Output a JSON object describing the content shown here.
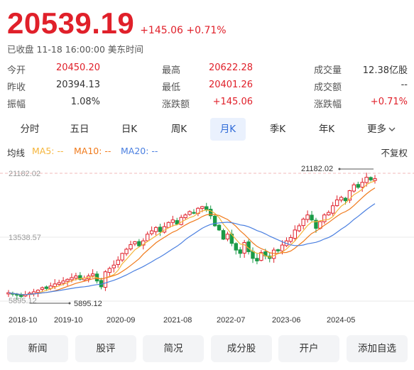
{
  "quote": {
    "price": "20539.19",
    "change": "+145.06",
    "change_pct": "+0.71%",
    "status": "已收盘 11-18 16:00:00 美东时间"
  },
  "stats": [
    [
      {
        "label": "今开",
        "value": "20450.20",
        "color": "red"
      },
      {
        "label": "最高",
        "value": "20622.28",
        "color": "red"
      },
      {
        "label": "成交量",
        "value": "12.38亿股",
        "color": "dark"
      }
    ],
    [
      {
        "label": "昨收",
        "value": "20394.13",
        "color": "dark"
      },
      {
        "label": "最低",
        "value": "20401.26",
        "color": "red"
      },
      {
        "label": "成交额",
        "value": "--",
        "color": "dark"
      }
    ],
    [
      {
        "label": "振幅",
        "value": "1.08%",
        "color": "dark"
      },
      {
        "label": "涨跌额",
        "value": "+145.06",
        "color": "red"
      },
      {
        "label": "涨跌幅",
        "value": "+0.71%",
        "color": "red"
      }
    ]
  ],
  "tabs": [
    "分时",
    "五日",
    "日K",
    "周K",
    "月K",
    "季K",
    "年K",
    "更多"
  ],
  "active_tab": "月K",
  "indicators": {
    "label": "均线",
    "ma5": "MA5: --",
    "ma10": "MA10: --",
    "ma20": "MA20: --",
    "adjust": "不复权"
  },
  "colors": {
    "up": "#e0202a",
    "down": "#1a9a46",
    "ma5": "#f5b53b",
    "ma10": "#f07a1c",
    "ma20": "#4a7fe0",
    "accent": "#2f6bd8"
  },
  "chart_data": {
    "type": "candlestick",
    "y_tick_labels": [
      "21182.02",
      "13538.57",
      "5895.12"
    ],
    "x_tick_labels": [
      "2018-10",
      "2019-10",
      "2020-09",
      "2021-08",
      "2022-07",
      "2023-06",
      "2024-05"
    ],
    "ylim": [
      5895.12,
      21182.02
    ],
    "max_marker": "21182.02",
    "min_marker": "5895.12",
    "closes": [
      6900,
      6750,
      6600,
      6450,
      6700,
      6850,
      7000,
      7200,
      7500,
      7400,
      7700,
      7950,
      8100,
      8300,
      8500,
      8700,
      8900,
      8500,
      8650,
      8900,
      9150,
      8300,
      7600,
      9400,
      9800,
      10200,
      10800,
      11600,
      12100,
      12650,
      13000,
      12500,
      13100,
      13900,
      14300,
      14700,
      14200,
      14800,
      15300,
      15600,
      15100,
      15900,
      16200,
      16600,
      16400,
      17000,
      17200,
      16800,
      16100,
      14900,
      14400,
      13300,
      13900,
      12800,
      12000,
      11600,
      12900,
      11800,
      11000,
      10700,
      11700,
      11300,
      11000,
      12000,
      11900,
      12600,
      13100,
      13500,
      14400,
      14900,
      15700,
      16200,
      15600,
      14600,
      15400,
      16200,
      16500,
      17300,
      18000,
      18300,
      17900,
      19100,
      19800,
      19500,
      20100,
      20700,
      20394,
      20539
    ]
  },
  "buttons": [
    "新闻",
    "股评",
    "简况",
    "成分股",
    "开户",
    "添加自选"
  ]
}
